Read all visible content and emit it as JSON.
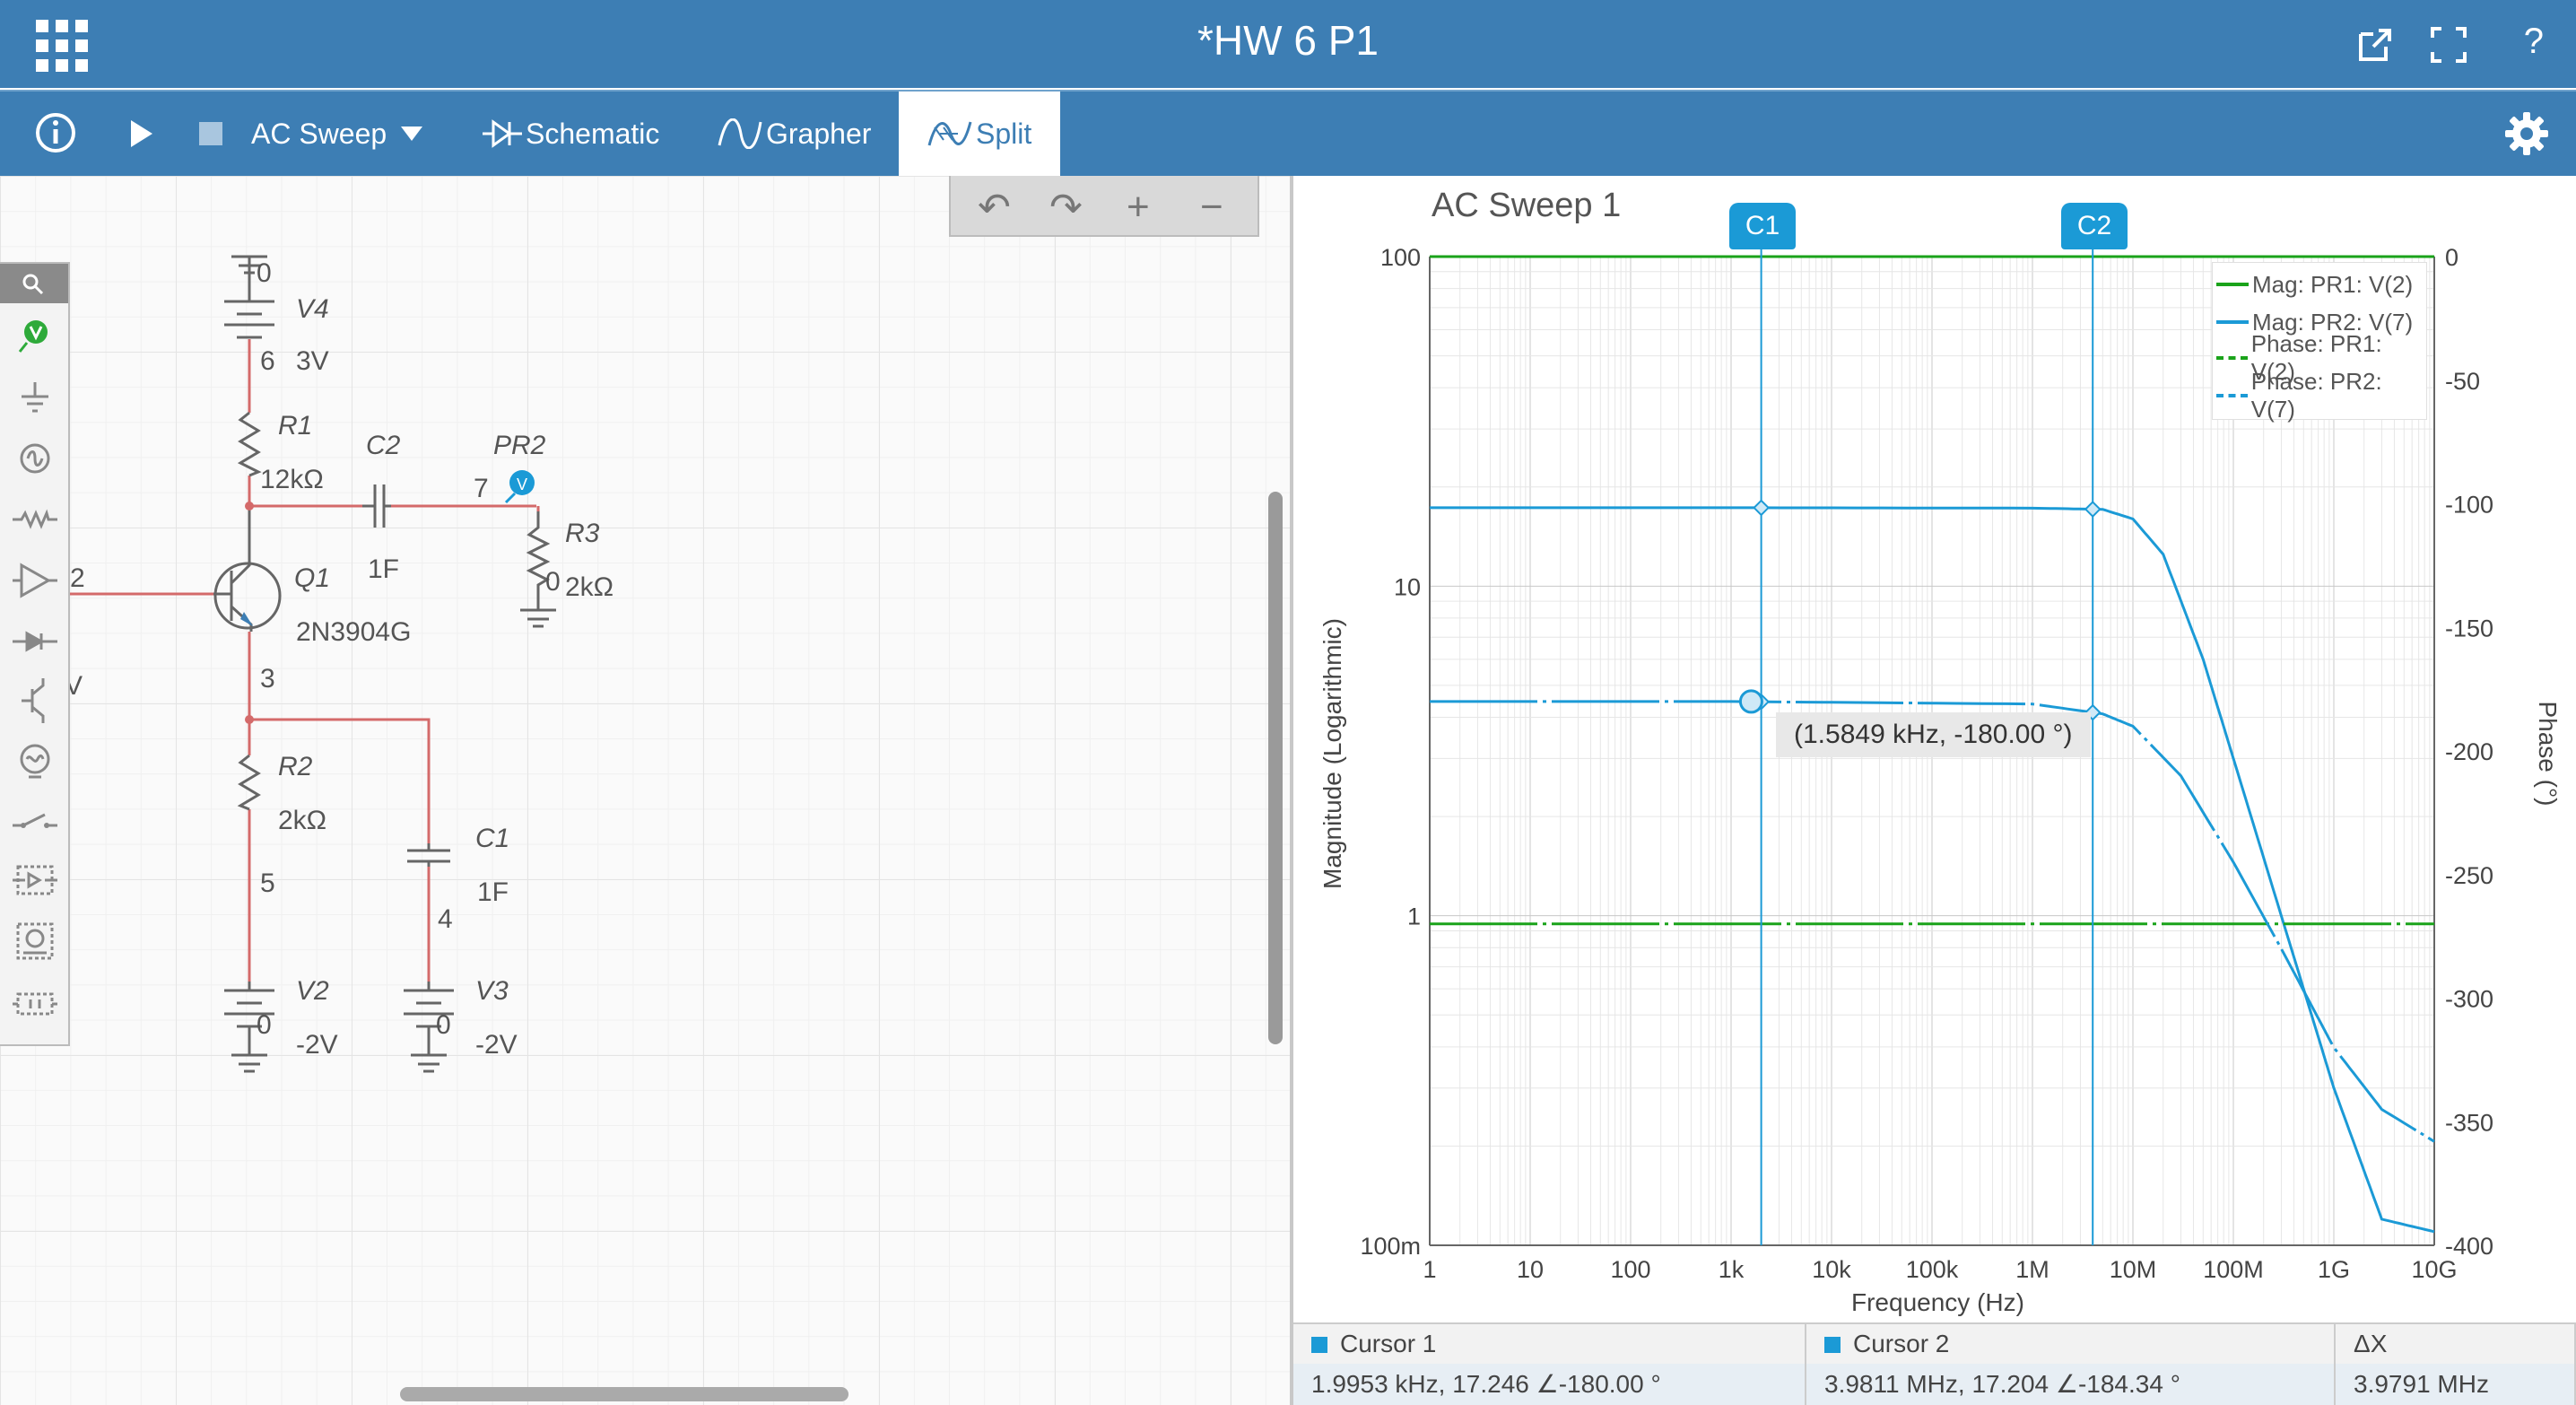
{
  "window": {
    "title": "*HW 6 P1"
  },
  "toolbar": {
    "analysis": "AC Sweep",
    "tabs": [
      {
        "label": "Schematic"
      },
      {
        "label": "Grapher"
      },
      {
        "label": "Split"
      }
    ]
  },
  "schematic": {
    "labels": {
      "v4": "V4",
      "v4_val": "3V",
      "v4_node0": "0",
      "v4_node6": "6",
      "r1": "R1",
      "r1_val": "12kΩ",
      "c2": "C2",
      "c2_val": "1F",
      "pr2": "PR2",
      "node7": "7",
      "r3": "R3",
      "r3_val": "2kΩ",
      "r3_node0": "0",
      "q1": "Q1",
      "q1_model": "2N3904G",
      "node2": "2",
      "node3": "3",
      "r2": "R2",
      "r2_val": "2kΩ",
      "node5": "5",
      "c1": "C1",
      "c1_val": "1F",
      "node4": "4",
      "v2": "V2",
      "v2_val": "-2V",
      "v2_node0": "0",
      "v3": "V3",
      "v3_val": "-2V",
      "v3_node0": "0",
      "offscreen_v": "V",
      "probe_v": "V"
    }
  },
  "grapher": {
    "title": "AC Sweep 1",
    "legend": [
      {
        "label": "Mag: PR1: V(2)",
        "color": "#1aa31a",
        "style": "solid"
      },
      {
        "label": "Mag: PR2: V(7)",
        "color": "#1b9ad6",
        "style": "solid"
      },
      {
        "label": "Phase: PR1: V(2)",
        "color": "#1aa31a",
        "style": "dashdot"
      },
      {
        "label": "Phase: PR2: V(7)",
        "color": "#1b9ad6",
        "style": "dashdot"
      }
    ],
    "cursor_tags": [
      "C1",
      "C2"
    ],
    "tooltip": "(1.5849 kHz, -180.00 °)"
  },
  "chart_data": {
    "type": "line",
    "title": "AC Sweep 1",
    "xlabel": "Frequency (Hz)",
    "ylabel": "Magnitude (Logarithmic)",
    "y2label": "Phase (°)",
    "xscale": "log",
    "yscale": "log",
    "xlim": [
      1,
      10000000000
    ],
    "ylim": [
      0.1,
      100
    ],
    "y2lim": [
      -400,
      0
    ],
    "x_ticks": [
      "1",
      "10",
      "100",
      "1k",
      "10k",
      "100k",
      "1M",
      "10M",
      "100M",
      "1G",
      "10G"
    ],
    "y_ticks": [
      "100",
      "10",
      "1",
      "100m"
    ],
    "y2_ticks": [
      "0",
      "-50",
      "-100",
      "-150",
      "-200",
      "-250",
      "-300",
      "-350",
      "-400"
    ],
    "grid": true,
    "legend_position": "top-right",
    "series": [
      {
        "name": "Mag: PR1: V(2)",
        "axis": "left",
        "x": [
          1,
          10000000000
        ],
        "y": [
          100,
          100
        ]
      },
      {
        "name": "Mag: PR2: V(7)",
        "axis": "left",
        "x": [
          1,
          1000,
          1000000,
          5000000,
          10000000,
          20000000,
          50000000,
          100000000,
          300000000,
          1000000000,
          3000000000,
          10000000000
        ],
        "y": [
          17.3,
          17.3,
          17.25,
          17.1,
          16.0,
          12.5,
          6.0,
          3.0,
          1.0,
          0.3,
          0.12,
          0.11
        ]
      },
      {
        "name": "Phase: PR1: V(2)",
        "axis": "right",
        "x": [
          1,
          10000000000
        ],
        "y": [
          -270,
          -270
        ]
      },
      {
        "name": "Phase: PR2: V(7)",
        "axis": "right",
        "x": [
          1,
          1000,
          1000000,
          5000000,
          10000000,
          30000000,
          100000000,
          300000000,
          1000000000,
          3000000000,
          10000000000
        ],
        "y": [
          -180,
          -180,
          -181,
          -185,
          -190,
          -210,
          -245,
          -280,
          -320,
          -345,
          -358
        ]
      }
    ],
    "cursors": [
      {
        "label": "C1",
        "x": 1995.3
      },
      {
        "label": "C2",
        "x": 3981100
      }
    ]
  },
  "cursor_table": {
    "headers": [
      "Cursor 1",
      "Cursor 2",
      "ΔX"
    ],
    "values": [
      "1.9953 kHz, 17.246 ∠-180.00 °",
      "3.9811 MHz, 17.204 ∠-184.34 °",
      "3.9791 MHz"
    ]
  },
  "colors": {
    "header": "#3d7eb4",
    "green": "#1aa31a",
    "blue": "#1b9ad6",
    "wire": "#d46a6a"
  }
}
